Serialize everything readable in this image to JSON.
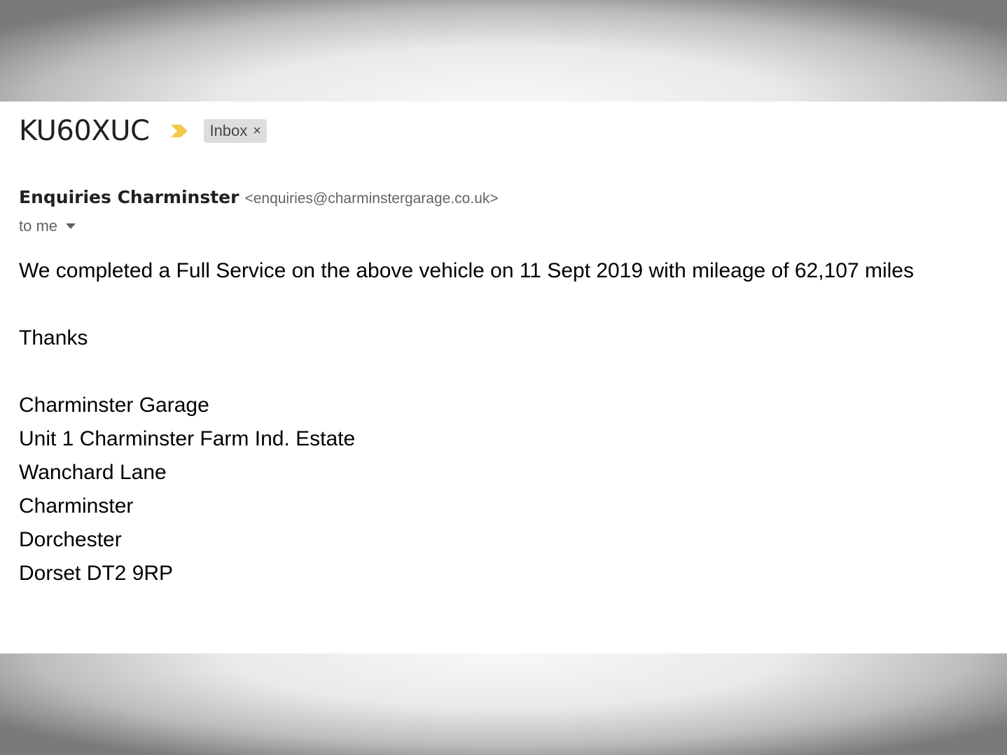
{
  "email": {
    "subject": "KU60XUC",
    "importance_icon": "importance-marker-icon",
    "label": "Inbox",
    "label_remove": "×",
    "sender_name": "Enquiries Charminster",
    "sender_email": "<enquiries@charminstergarage.co.uk>",
    "recipient": "to me",
    "body": {
      "message": "We completed a Full Service on the above vehicle on 11 Sept 2019 with mileage of 62,107 miles",
      "signoff": "Thanks",
      "signature": [
        "Charminster Garage",
        "Unit 1 Charminster Farm Ind. Estate",
        "Wanchard Lane",
        "Charminster",
        "Dorchester",
        "Dorset DT2 9RP"
      ]
    }
  },
  "colors": {
    "importance": "#f2c94c",
    "chip_background": "#dddddd",
    "secondary_text": "#5f6368"
  }
}
